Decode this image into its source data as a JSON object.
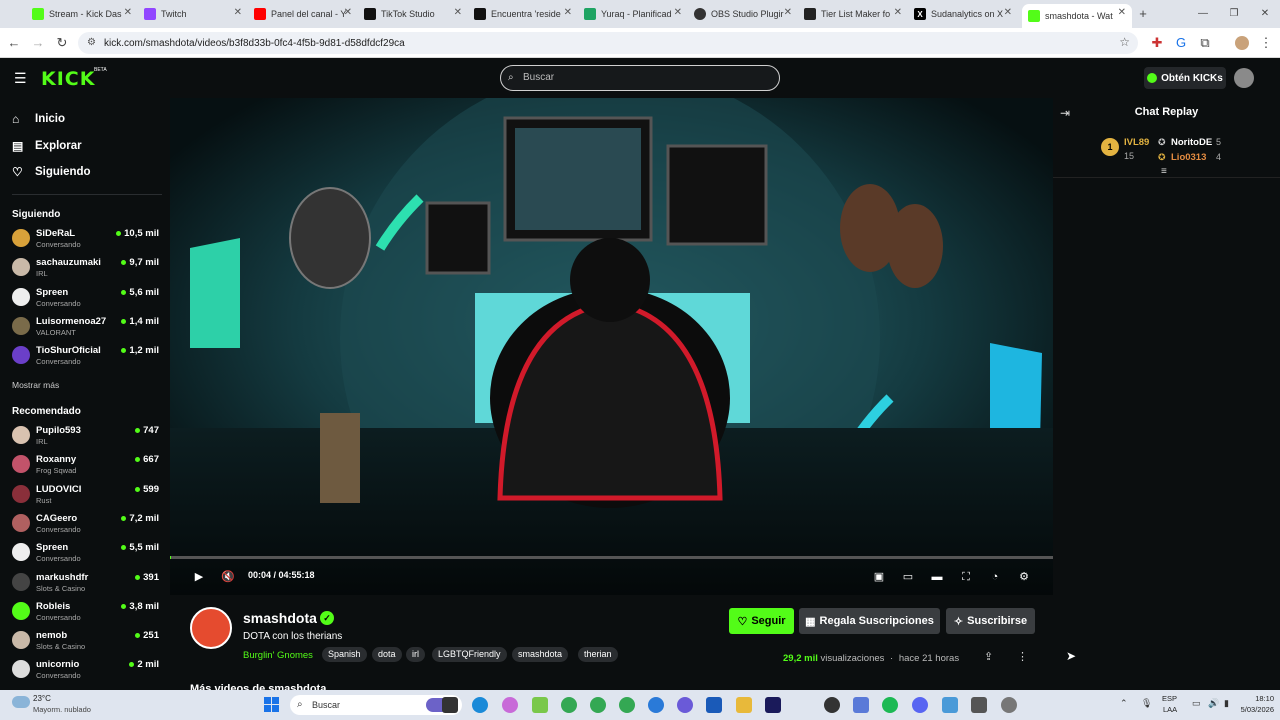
{
  "browser": {
    "tabs": [
      {
        "label": "Stream - Kick Das",
        "color": "#53fc18"
      },
      {
        "label": "Twitch",
        "color": "#9146ff"
      },
      {
        "label": "Panel del canal - Y",
        "color": "#ff0000"
      },
      {
        "label": "TikTok Studio",
        "color": "#111111"
      },
      {
        "label": "Encuentra 'reside",
        "color": "#111111"
      },
      {
        "label": "Yuraq - Planificad",
        "color": "#1fa463"
      },
      {
        "label": "OBS Studio Plugir",
        "color": "#333333"
      },
      {
        "label": "Tier List Maker fo",
        "color": "#222222"
      },
      {
        "label": "Sudanalytics on X",
        "color": "#000000"
      },
      {
        "label": "smashdota - Wat",
        "color": "#53fc18"
      }
    ],
    "url": "kick.com/smashdota/videos/b3f8d33b-0fc4-4f5b-9d81-d58dfdcf29ca"
  },
  "topnav": {
    "logo": "KICK",
    "logo_beta": "BETA",
    "search_placeholder": "Buscar",
    "get_kicks": "Obtén KICKs"
  },
  "sidebar": {
    "nav": [
      {
        "label": "Inicio",
        "icon": "home-icon"
      },
      {
        "label": "Explorar",
        "icon": "explore-icon"
      },
      {
        "label": "Siguiendo",
        "icon": "heart-icon"
      }
    ],
    "following_heading": "Siguiendo",
    "following": [
      {
        "name": "SiDeRaL",
        "category": "Conversando",
        "viewers": "10,5 mil",
        "color": "#d8a13a"
      },
      {
        "name": "sachauzumaki",
        "category": "IRL",
        "viewers": "9,7 mil",
        "color": "#c9b9a8"
      },
      {
        "name": "Spreen",
        "category": "Conversando",
        "viewers": "5,6 mil",
        "color": "#eeeeee"
      },
      {
        "name": "Luisormenoa27",
        "category": "VALORANT",
        "viewers": "1,4 mil",
        "color": "#7a6b4a"
      },
      {
        "name": "TioShurOficial",
        "category": "Conversando",
        "viewers": "1,2 mil",
        "color": "#6b3fc9"
      }
    ],
    "show_more": "Mostrar más",
    "recommended_heading": "Recomendado",
    "recommended": [
      {
        "name": "Pupilo593",
        "category": "IRL",
        "viewers": "747",
        "color": "#d9c2b0"
      },
      {
        "name": "Roxanny",
        "category": "Frog Sqwad",
        "viewers": "667",
        "color": "#c2536a"
      },
      {
        "name": "LUDOVICI",
        "category": "Rust",
        "viewers": "599",
        "color": "#8a2f3a"
      },
      {
        "name": "CAGeero",
        "category": "Conversando",
        "viewers": "7,2 mil",
        "color": "#b06060"
      },
      {
        "name": "Spreen",
        "category": "Conversando",
        "viewers": "5,5 mil",
        "color": "#eeeeee"
      },
      {
        "name": "markushdfr",
        "category": "Slots & Casino",
        "viewers": "391",
        "color": "#444444"
      },
      {
        "name": "Robleis",
        "category": "Conversando",
        "viewers": "3,8 mil",
        "color": "#53fc18"
      },
      {
        "name": "nemob",
        "category": "Slots & Casino",
        "viewers": "251",
        "color": "#c9b9a8"
      },
      {
        "name": "unicornio",
        "category": "Conversando",
        "viewers": "2 mil",
        "color": "#dddddd"
      }
    ]
  },
  "player": {
    "time": "00:04 / 04:55:18",
    "progress": 0.0002
  },
  "channel": {
    "name": "smashdota",
    "title": "DOTA con los therians",
    "category": "Burglin' Gnomes",
    "tags": [
      "Spanish",
      "dota",
      "irl",
      "LGBTQFriendly",
      "smashdota",
      "therian"
    ],
    "follow": "Seguir",
    "gift": "Regala Suscripciones",
    "subscribe": "Suscribirse",
    "views_count": "29,2 mil",
    "views_label": "visualizaciones",
    "ago": "hace 21 horas",
    "more_videos": "Más videos de smashdota"
  },
  "chat": {
    "title": "Chat Replay",
    "leaders": [
      {
        "rank": "1",
        "name": "IVL89",
        "count": "15"
      },
      {
        "name": "NoritoDE",
        "count": "5"
      },
      {
        "name": "Lio0313",
        "count": "4"
      }
    ]
  },
  "taskbar": {
    "weather_temp": "23°C",
    "weather_desc": "Mayorm. nublado",
    "search": "Buscar",
    "lang1": "ESP",
    "lang2": "LAA",
    "time": "18:10",
    "date": "5/03/2026"
  },
  "colors": {
    "accent": "#53fc18",
    "bg": "#0b0e0f"
  }
}
